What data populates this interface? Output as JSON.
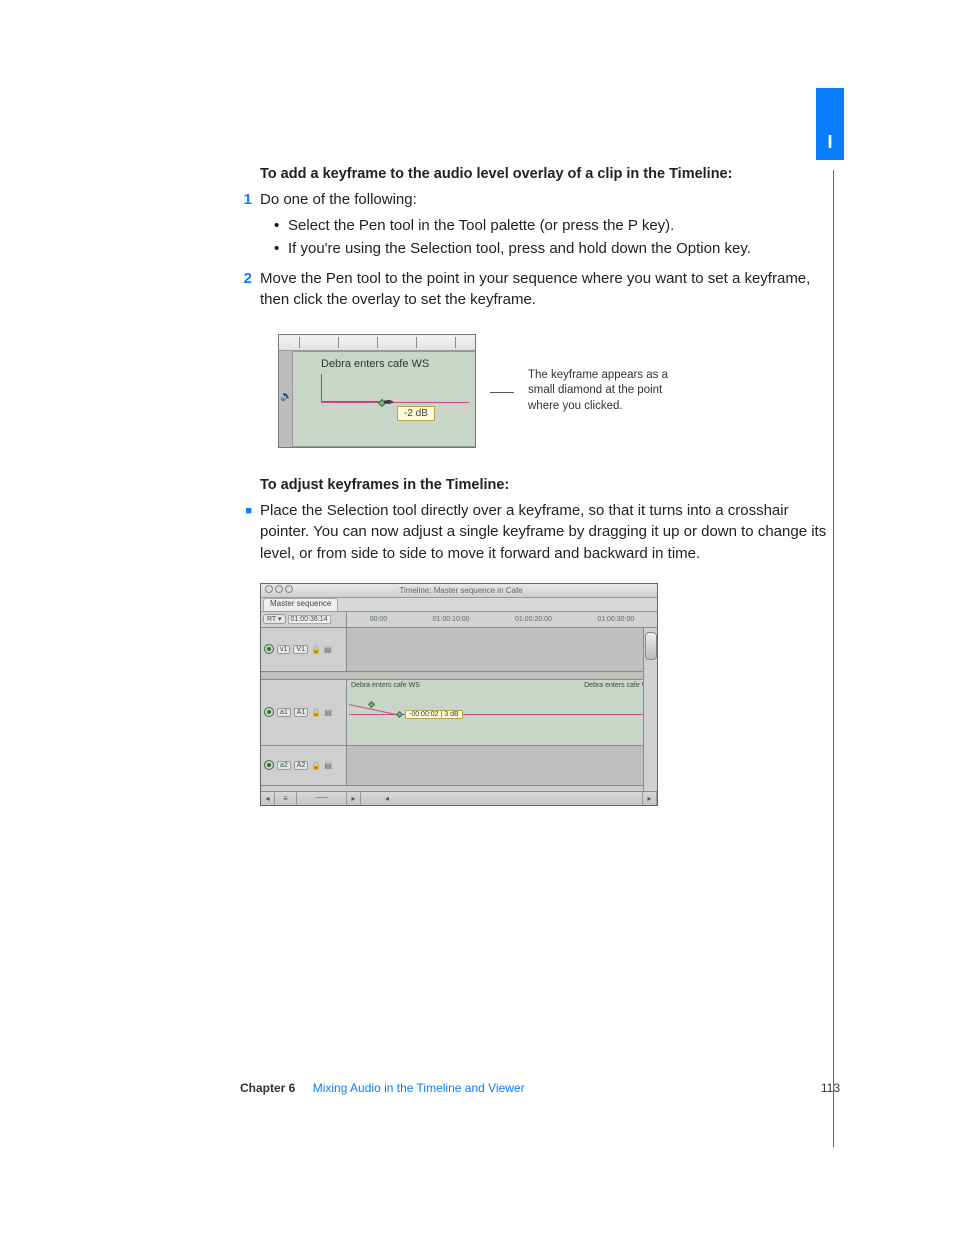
{
  "tab_label": "I",
  "section1_heading": "To add a keyframe to the audio level overlay of a clip in the Timeline:",
  "step1_num": "1",
  "step1_text": "Do one of the following:",
  "step1_bullets": [
    "Select the Pen tool in the Tool palette (or press the P key).",
    "If you're using the Selection tool, press and hold down the Option key."
  ],
  "step2_num": "2",
  "step2_text": "Move the Pen tool to the point in your sequence where you want to set a keyframe, then click the overlay to set the keyframe.",
  "fig1": {
    "clip_name": "Debra enters cafe WS",
    "tooltip": "-2 dB",
    "caption": "The keyframe appears as a small diamond at the point where you clicked."
  },
  "section2_heading": "To adjust keyframes in the Timeline:",
  "section2_text": "Place the Selection tool directly over a keyframe, so that it turns into a crosshair pointer. You can now adjust a single keyframe by dragging it up or down to change its level, or from side to side to move it forward and backward in time.",
  "fig2": {
    "window_title": "Timeline: Master sequence in Cafe",
    "tab": "Master sequence",
    "rt_label": "RT ▾",
    "timecode": "01:00:36:14",
    "ruler": [
      "00:00",
      "01:00:10:00",
      "01:00:20:00",
      "01:00:30:00"
    ],
    "tracks": {
      "v1": {
        "src": "v1",
        "dst": "V1"
      },
      "a1": {
        "src": "a1",
        "dst": "A1",
        "clip_left": "Debra enters cafe WS",
        "clip_right": "Debra enters cafe WS",
        "tooltip": "-00:00:02 |   3 dB"
      },
      "a2": {
        "src": "a2",
        "dst": "A2"
      }
    }
  },
  "footer": {
    "chapter_label": "Chapter 6",
    "chapter_title": "Mixing Audio in the Timeline and Viewer",
    "page": "113"
  }
}
